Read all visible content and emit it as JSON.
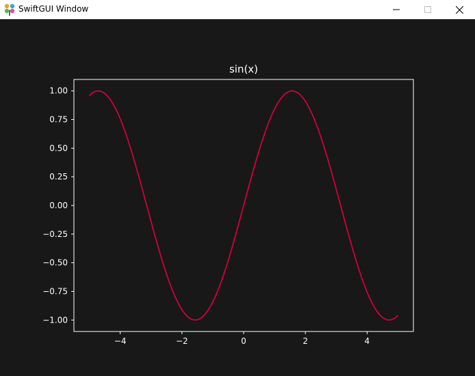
{
  "window": {
    "title": "SwiftGUI Window",
    "icon": "pinwheel-app-icon",
    "buttons": [
      "minimize-icon",
      "maximize-icon",
      "close-icon"
    ]
  },
  "colors": {
    "background": "#181818",
    "axes": "#ffffff",
    "line": "#d2003c"
  },
  "chart_data": {
    "type": "line",
    "title": "sin(x)",
    "function": "sin(x)",
    "x_range": [
      -5,
      5
    ],
    "samples": 200,
    "series": [
      {
        "values": "sin(x) sampled from x=-5 to x=5"
      }
    ],
    "xlim": [
      -5.5,
      5.5
    ],
    "ylim": [
      -1.1,
      1.1
    ],
    "xticks": [
      -4,
      -2,
      0,
      2,
      4
    ],
    "xtick_labels": [
      "−4",
      "−2",
      "0",
      "2",
      "4"
    ],
    "yticks": [
      1.0,
      0.75,
      0.5,
      0.25,
      0.0,
      -0.25,
      -0.5,
      -0.75,
      -1.0
    ],
    "ytick_labels": [
      "1.00",
      "0.75",
      "0.50",
      "0.25",
      "0.00",
      "−0.25",
      "−0.50",
      "−0.75",
      "−1.00"
    ],
    "grid": false,
    "legend": "none"
  }
}
